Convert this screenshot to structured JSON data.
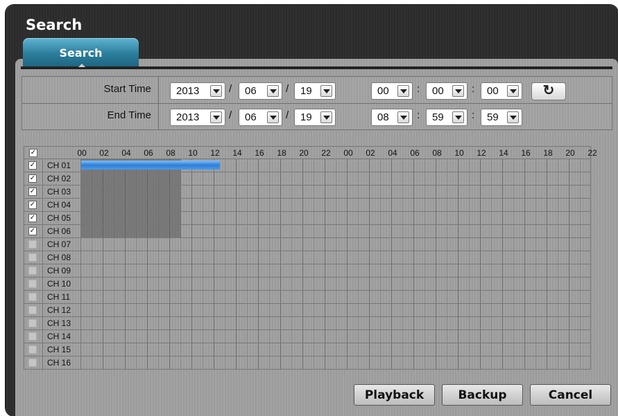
{
  "window": {
    "title": "Search"
  },
  "tab": {
    "label": "Search"
  },
  "start_time": {
    "label": "Start Time",
    "year": "2013",
    "month": "06",
    "day": "19",
    "hour": "00",
    "minute": "00",
    "second": "00"
  },
  "end_time": {
    "label": "End Time",
    "year": "2013",
    "month": "06",
    "day": "19",
    "hour": "08",
    "minute": "59",
    "second": "59"
  },
  "separators": {
    "date": "/",
    "time": ":"
  },
  "refresh_icon": "refresh-icon",
  "timeline": {
    "hour_labels": [
      "00",
      "02",
      "04",
      "06",
      "08",
      "10",
      "12",
      "14",
      "16",
      "18",
      "20",
      "22",
      "00",
      "02",
      "04",
      "06",
      "08",
      "10",
      "12",
      "14",
      "16",
      "18",
      "20",
      "22"
    ],
    "select_all_checked": true,
    "channels": [
      {
        "name": "CH 01",
        "checked": true,
        "recorded": true,
        "selected_range_hours": [
          0,
          12.5
        ]
      },
      {
        "name": "CH 02",
        "checked": true,
        "recorded": true
      },
      {
        "name": "CH 03",
        "checked": true,
        "recorded": true
      },
      {
        "name": "CH 04",
        "checked": true,
        "recorded": true
      },
      {
        "name": "CH 05",
        "checked": true,
        "recorded": true
      },
      {
        "name": "CH 06",
        "checked": true,
        "recorded": true
      },
      {
        "name": "CH 07",
        "checked": false,
        "recorded": false
      },
      {
        "name": "CH 08",
        "checked": false,
        "recorded": false
      },
      {
        "name": "CH 09",
        "checked": false,
        "recorded": false
      },
      {
        "name": "CH 10",
        "checked": false,
        "recorded": false
      },
      {
        "name": "CH 11",
        "checked": false,
        "recorded": false
      },
      {
        "name": "CH 12",
        "checked": false,
        "recorded": false
      },
      {
        "name": "CH 13",
        "checked": false,
        "recorded": false
      },
      {
        "name": "CH 14",
        "checked": false,
        "recorded": false
      },
      {
        "name": "CH 15",
        "checked": false,
        "recorded": false
      },
      {
        "name": "CH 16",
        "checked": false,
        "recorded": false
      }
    ],
    "recorded_range_hours": [
      0,
      9
    ]
  },
  "buttons": {
    "playback": "Playback",
    "backup": "Backup",
    "cancel": "Cancel"
  },
  "colors": {
    "tab_accent": "#2c7d9c",
    "selection_blue": "#2f7fd8"
  }
}
